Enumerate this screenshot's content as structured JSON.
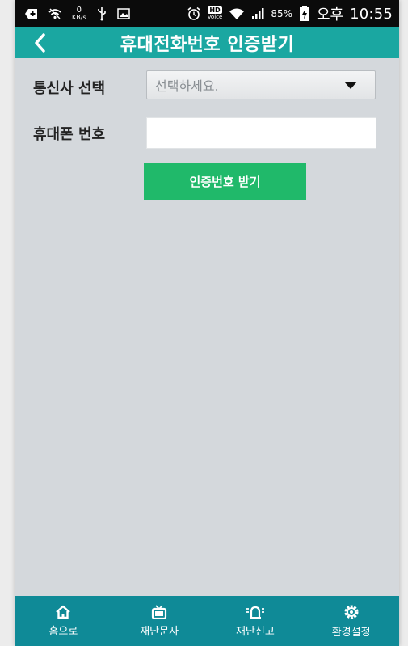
{
  "status_bar": {
    "speed_value": "0",
    "speed_unit": "KB/s",
    "voice_label": "Voice",
    "battery_percent": "85%",
    "ampm": "오후",
    "time": "10:55"
  },
  "header": {
    "title": "휴대전화번호 인증받기"
  },
  "form": {
    "carrier_label": "통신사 선택",
    "carrier_select_value": "선택하세요.",
    "phone_label": "휴대폰 번호",
    "phone_value": "",
    "verify_button_label": "인증번호 받기"
  },
  "bottom_nav": {
    "items": [
      {
        "label": "홈으로",
        "icon": "home-icon"
      },
      {
        "label": "재난문자",
        "icon": "tv-icon"
      },
      {
        "label": "재난신고",
        "icon": "siren-icon"
      },
      {
        "label": "환경설정",
        "icon": "gear-icon"
      }
    ]
  },
  "colors": {
    "header_bg": "#1aa7a1",
    "nav_bg": "#0f8a97",
    "button_bg": "#20b96a",
    "content_bg": "#d4d8dc"
  }
}
